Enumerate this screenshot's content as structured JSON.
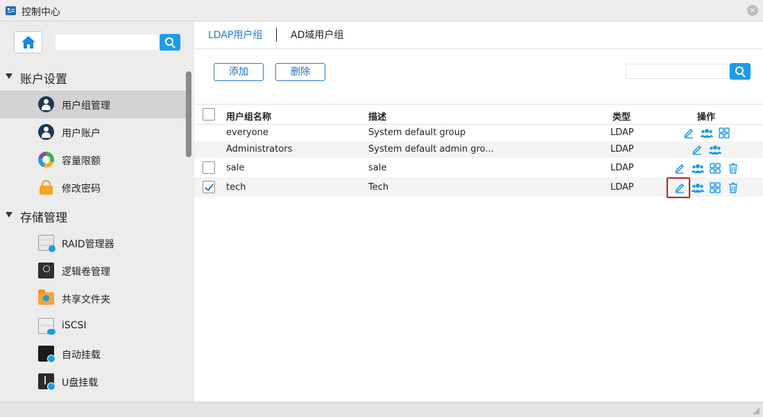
{
  "window": {
    "title": "控制中心",
    "close_glyph": "×"
  },
  "sidebar": {
    "search": {
      "value": "",
      "placeholder": ""
    },
    "sections": [
      {
        "label": "账户设置",
        "items": [
          {
            "label": "用户组管理",
            "icon": "user-group-icon",
            "active": true
          },
          {
            "label": "用户账户",
            "icon": "user-account-icon"
          },
          {
            "label": "容量限额",
            "icon": "quota-icon"
          },
          {
            "label": "修改密码",
            "icon": "lock-icon"
          }
        ]
      },
      {
        "label": "存储管理",
        "items": [
          {
            "label": "RAID管理器",
            "icon": "raid-icon"
          },
          {
            "label": "逻辑卷管理",
            "icon": "lvm-icon"
          },
          {
            "label": "共享文件夹",
            "icon": "shared-folder-icon"
          },
          {
            "label": "iSCSI",
            "icon": "iscsi-icon"
          },
          {
            "label": "自动挂载",
            "icon": "auto-mount-icon"
          },
          {
            "label": "U盘挂载",
            "icon": "usb-mount-icon"
          }
        ]
      }
    ]
  },
  "tabs": [
    {
      "label": "LDAP用户组",
      "active": true
    },
    {
      "label": "AD域用户组",
      "active": false
    }
  ],
  "toolbar": {
    "add_label": "添加",
    "delete_label": "删除",
    "search_value": "",
    "search_placeholder": ""
  },
  "table": {
    "headers": {
      "name": "用户组名称",
      "desc": "描述",
      "type": "类型",
      "actions": "操作"
    },
    "rows": [
      {
        "name": "everyone",
        "desc": "System default group",
        "type": "LDAP",
        "checkbox": false,
        "checked": false,
        "actions": [
          "edit",
          "members",
          "permissions"
        ]
      },
      {
        "name": "Administrators",
        "desc": "System default admin gro...",
        "type": "LDAP",
        "checkbox": false,
        "checked": false,
        "actions": [
          "edit",
          "members"
        ]
      },
      {
        "name": "sale",
        "desc": "sale",
        "type": "LDAP",
        "checkbox": true,
        "checked": false,
        "actions": [
          "edit",
          "members",
          "permissions",
          "delete"
        ]
      },
      {
        "name": "tech",
        "desc": "Tech",
        "type": "LDAP",
        "checkbox": true,
        "checked": true,
        "actions": [
          "edit",
          "members",
          "permissions",
          "delete"
        ]
      }
    ]
  },
  "colors": {
    "accent": "#1e9be8",
    "link": "#1e7ccc",
    "highlight": "#b52a2a"
  }
}
